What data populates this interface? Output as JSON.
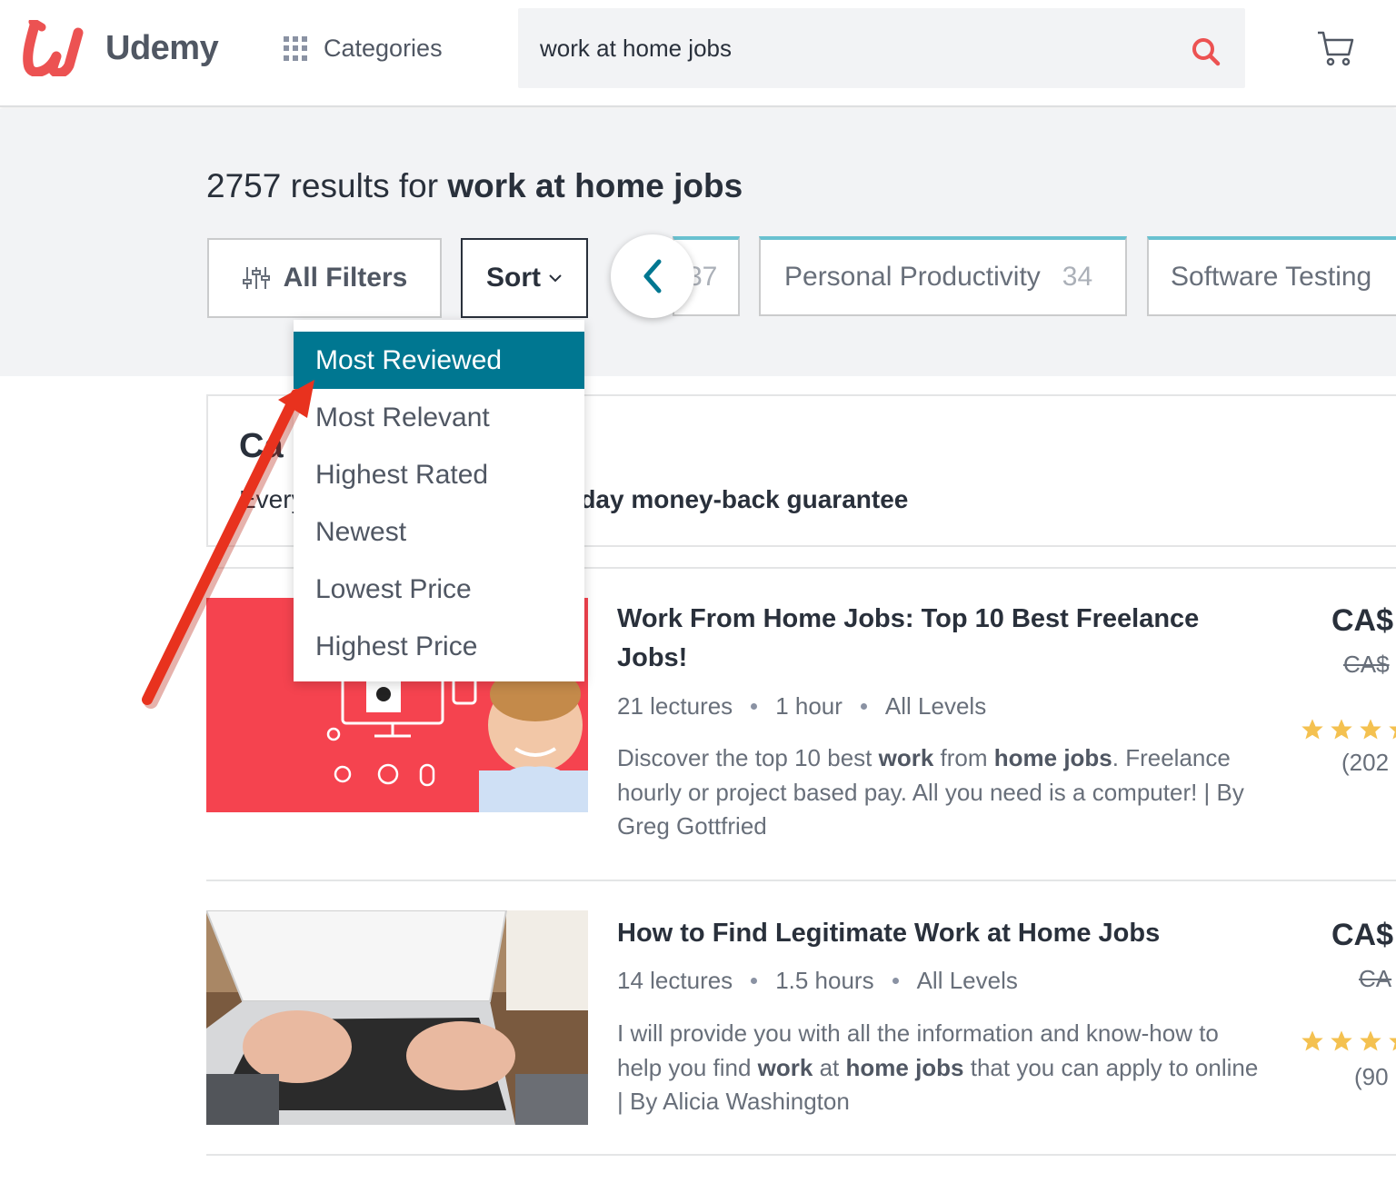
{
  "header": {
    "brand": "Udemy",
    "categories_label": "Categories",
    "search_value": "work at home jobs",
    "icons": {
      "logo": "udemy-u-logo",
      "categories": "grid-icon",
      "search": "search-icon",
      "cart": "cart-icon"
    },
    "accent_color": "#ec5252"
  },
  "results": {
    "count": "2757",
    "prefix": "results for",
    "query": "work at home jobs"
  },
  "toolbar": {
    "filters_label": "All Filters",
    "sort_label": "Sort",
    "pills": [
      {
        "label": "",
        "count": "37"
      },
      {
        "label": "Personal Productivity",
        "count": "34"
      },
      {
        "label": "Software Testing",
        "count": ""
      }
    ]
  },
  "sort_menu": {
    "items": [
      {
        "label": "Most Reviewed",
        "selected": true
      },
      {
        "label": "Most Relevant",
        "selected": false
      },
      {
        "label": "Highest Rated",
        "selected": false
      },
      {
        "label": "Newest",
        "selected": false
      },
      {
        "label": "Lowest Price",
        "selected": false
      },
      {
        "label": "Highest Price",
        "selected": false
      }
    ],
    "selected_color": "#007791"
  },
  "notice": {
    "title_visible": "Ca",
    "text_visible": "Every",
    "bold_visible": "-day money-back guarantee"
  },
  "courses": [
    {
      "title": "Work From Home Jobs: Top 10 Best Freelance Jobs!",
      "lectures": "21 lectures",
      "duration": "1 hour",
      "level": "All Levels",
      "desc_1": "Discover the top 10 best ",
      "desc_b1": "work",
      "desc_2": " from ",
      "desc_b2": "home jobs",
      "desc_3": ". Freelance hourly or project based pay. All you need is a computer! | By Greg Gottfried",
      "price": "CA$",
      "old_price": "CA$",
      "reviews": "(202",
      "rating_stars": 3
    },
    {
      "title": "How to Find Legitimate Work at Home Jobs",
      "lectures": "14 lectures",
      "duration": "1.5 hours",
      "level": "All Levels",
      "desc_1": "I will provide you with all the information and know-how to help you find ",
      "desc_b1": "work",
      "desc_2": " at ",
      "desc_b2": "home jobs",
      "desc_3": " that you can apply to online | By Alicia Washington",
      "price": "CA$",
      "old_price": "CA",
      "reviews": "(90",
      "rating_stars": 3
    }
  ],
  "annotation": {
    "arrow_color": "#e8321e"
  }
}
